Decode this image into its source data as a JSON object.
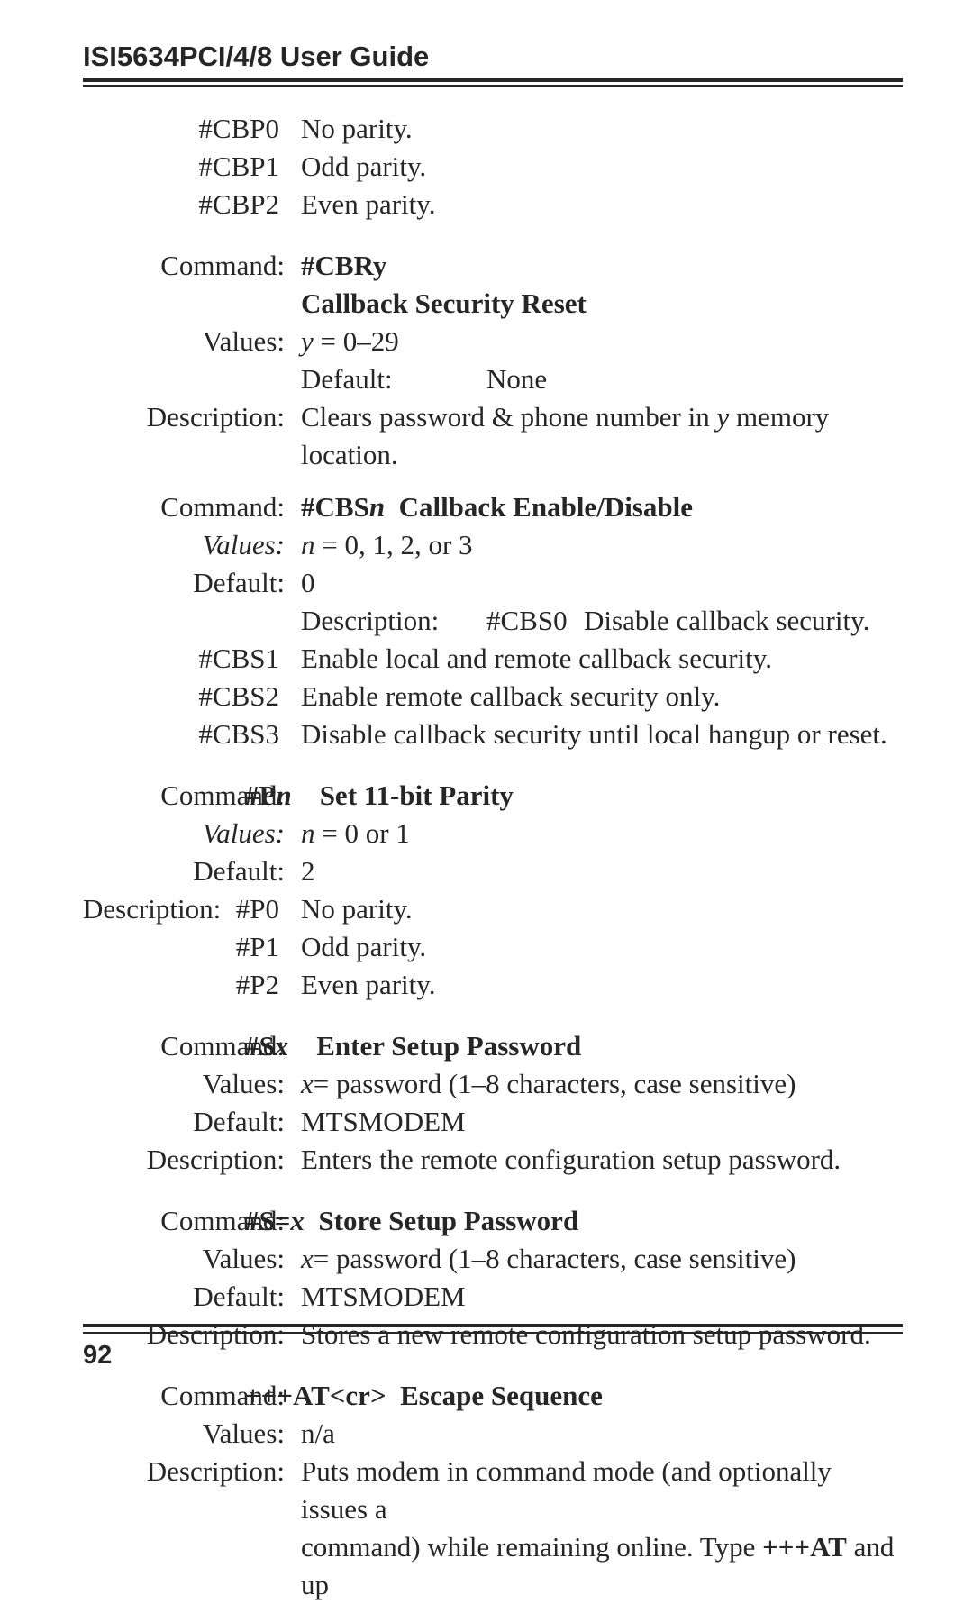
{
  "header": {
    "title": "ISI5634PCI/4/8 User Guide"
  },
  "page_number": "92",
  "cbp": {
    "rows": [
      {
        "k": "#CBP0",
        "v": "No parity."
      },
      {
        "k": "#CBP1",
        "v": "Odd parity."
      },
      {
        "k": "#CBP2",
        "v": "Even parity."
      }
    ]
  },
  "cbr": {
    "command_label": "Command:",
    "command_code": "#CBRy",
    "title": "Callback Security Reset",
    "values_label": "Values:",
    "values_text_a": "y",
    "values_text_b": " = 0–29",
    "default_label": "Default:",
    "default_value": "None",
    "description_label": "Description:",
    "description_a": "Clears password & phone number in ",
    "description_b": "y",
    "description_c": " memory location."
  },
  "cbs": {
    "command_label": "Command:",
    "command_code_a": "#CBS",
    "command_code_b": "n",
    "title": "Callback Enable/Disable",
    "values_label": "Values:",
    "values_text_a": "n",
    "values_text_b": " = 0, 1, 2, or 3",
    "default_label": "Default:",
    "default_value": "0",
    "desc_label": "Description:",
    "rows": [
      {
        "k": "#CBS0",
        "v": "Disable callback security."
      },
      {
        "k": "#CBS1",
        "v": "Enable local and remote callback security."
      },
      {
        "k": "#CBS2",
        "v": "Enable remote callback security only."
      },
      {
        "k": "#CBS3",
        "v": "Disable callback security until local hangup or reset."
      }
    ]
  },
  "p": {
    "command_label": "Command:",
    "command_code_a": "#P",
    "command_code_b": "n",
    "title": "Set 11-bit Parity",
    "values_label": "Values:",
    "values_text_a": "n",
    "values_text_b": " = 0 or 1",
    "default_label": "Default:",
    "default_value": "2",
    "description_label_left": "Description:",
    "description_label_right": "#P0",
    "rows": [
      {
        "k": "#P0",
        "v": "No parity."
      },
      {
        "k": "#P1",
        "v": "Odd parity."
      },
      {
        "k": "#P2",
        "v": "Even parity."
      }
    ]
  },
  "sx": {
    "command_label": "Command:",
    "command_code_a": "#S",
    "command_code_b": "x",
    "title": "Enter Setup Password",
    "values_label": "Values:",
    "values_text_a": "x",
    "values_text_b": "= password (1–8 characters, case sensitive)",
    "default_label": "Default:",
    "default_value": "MTSMODEM",
    "description_label": "Description:",
    "description_value": "Enters the remote configuration setup password."
  },
  "ssx": {
    "command_label": "Command:",
    "command_code_a": "#S=",
    "command_code_b": "x",
    "title": "Store Setup Password",
    "values_label": "Values:",
    "values_text_a": "x",
    "values_text_b": "= password (1–8 characters, case sensitive)",
    "default_label": "Default:",
    "default_value": "MTSMODEM",
    "description_label": "Description:",
    "description_value": "Stores a new remote configuration setup password."
  },
  "esc": {
    "command_label": "Command:",
    "command_code": "+++AT<cr>",
    "title": "Escape Sequence",
    "values_label": "Values:",
    "values_text": "n/a",
    "description_label": "Description:",
    "description_line1_a": "Puts modem in command mode (and optionally issues a",
    "description_line2_a": "command) while remaining online. Type ",
    "description_line2_b": "+++AT",
    "description_line2_c": " and up"
  }
}
